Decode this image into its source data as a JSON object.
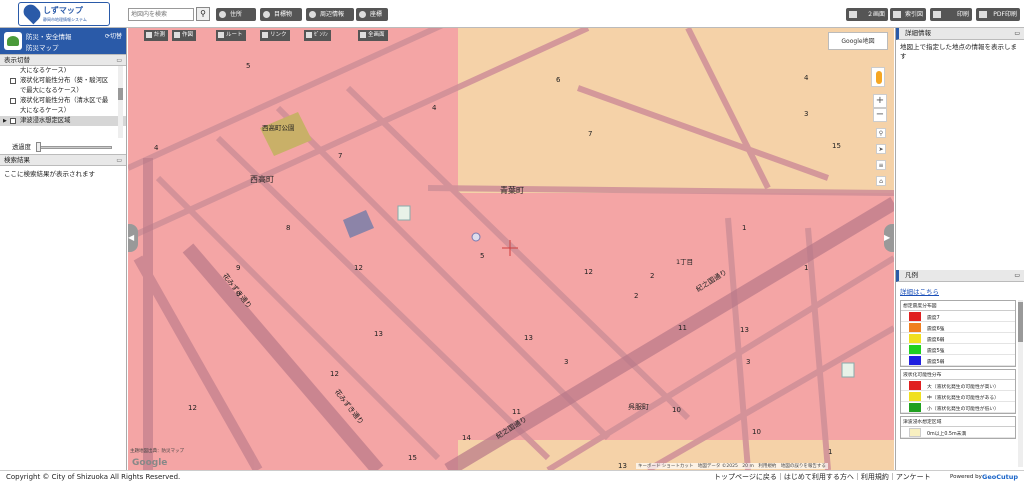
{
  "header": {
    "logo_title": "しずマップ",
    "logo_sub": "静岡市地理情報システム",
    "search_placeholder": "地図内を検索",
    "search_icon": "search-icon",
    "buttons": [
      "住所",
      "目標物",
      "周辺情報",
      "座標"
    ],
    "right_buttons": [
      "２画面",
      "索引図",
      "印刷",
      "PDF印刷"
    ]
  },
  "left_panel": {
    "title_line1": "防災・安全情報",
    "title_line2": "防災マップ",
    "switch_label": "切替",
    "display_section": "表示切替",
    "layers": [
      {
        "label": "大になるケース)",
        "checkbox": false,
        "selected": false
      },
      {
        "label": "液状化可能性分布（葵・駿河区で最大になるケース）",
        "checkbox": true,
        "selected": false
      },
      {
        "label": "液状化可能性分布（清水区で最大になるケース）",
        "checkbox": true,
        "selected": false
      },
      {
        "label": "津波浸水想定区域",
        "checkbox": true,
        "selected": true
      }
    ],
    "opacity_label": "透過度",
    "opacity_value": 0,
    "results_section": "検索結果",
    "results_text": "ここに検索結果が表示されます"
  },
  "map": {
    "tools": [
      "計測",
      "作図",
      "ルート",
      "リンク",
      "ｾﾞﾝﾘﾝ",
      "全画面"
    ],
    "google_map_button": "Google地図",
    "place_labels": [
      "西高町",
      "青葉町",
      "西高町公園",
      "1丁目",
      "呉服町",
      "1丁目"
    ],
    "road_labels": [
      "花みずき通り",
      "花みずき通り",
      "紀之国通り",
      "紀之国通り"
    ],
    "block_numbers": [
      "5",
      "4",
      "6",
      "4",
      "7",
      "3",
      "15",
      "9",
      "7",
      "4",
      "8",
      "1",
      "2",
      "5",
      "1",
      "12",
      "12",
      "2",
      "9",
      "11",
      "13",
      "13",
      "3",
      "11",
      "12",
      "3",
      "13",
      "12",
      "14",
      "15",
      "10",
      "10",
      "13",
      "1"
    ],
    "attribution_left": "主題地図出典：防災マップ",
    "google_logo": "Google",
    "attribution_right": "キーボード ショートカット　地図データ ©2025　20 m　利用規約　地図の誤りを報告する",
    "colors": {
      "tsunami_pink": "#f5a0a0",
      "base_orange": "#f5d0a0",
      "road": "#c8869a"
    }
  },
  "right_panel": {
    "detail_title": "詳細情報",
    "detail_text": "地図上で指定した地点の情報を表示します",
    "legend_title": "凡例",
    "legend_link": "詳細はこちら",
    "legend_groups": [
      {
        "title": "想定震度分布図",
        "items": [
          {
            "label": "震度7",
            "color": "#e02020"
          },
          {
            "label": "震度6強",
            "color": "#f08020"
          },
          {
            "label": "震度6弱",
            "color": "#f0e020"
          },
          {
            "label": "震度5強",
            "color": "#20d020"
          },
          {
            "label": "震度5弱",
            "color": "#2020e0"
          }
        ]
      },
      {
        "title": "液状化可能性分布",
        "items": [
          {
            "label": "大（液状化発生の可能性が高い）",
            "color": "#e02020"
          },
          {
            "label": "中（液状化発生の可能性がある）",
            "color": "#f0e020"
          },
          {
            "label": "小（液状化発生の可能性が低い）",
            "color": "#20a020"
          }
        ]
      },
      {
        "title": "津波浸水想定区域",
        "items": [
          {
            "label": "0m以上0.5m未満",
            "color": "#f8f0c0"
          }
        ]
      }
    ]
  },
  "footer": {
    "copyright": "Copyright © City of Shizuoka All Rights Reserved.",
    "links": "トップページに戻る｜はじめて利用する方へ｜利用規約｜アンケート",
    "powered": "Powered by",
    "brand": "GeoCutup"
  }
}
